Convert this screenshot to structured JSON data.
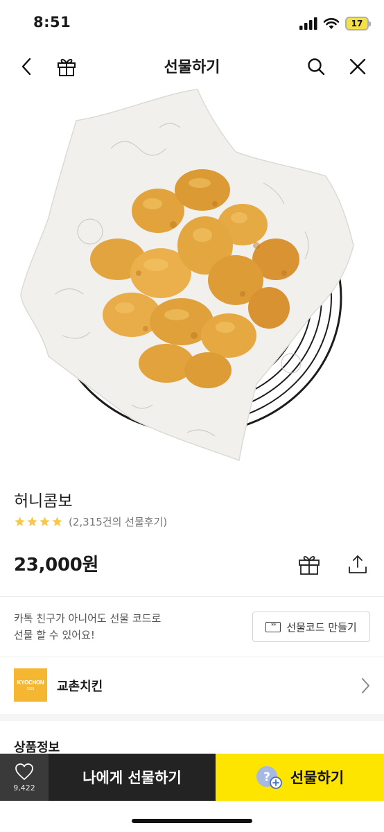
{
  "status_bar": {
    "time": "8:51",
    "battery": "17"
  },
  "nav": {
    "title": "선물하기",
    "back_icon": "chevron-left-icon",
    "gift_icon": "gift-icon",
    "search_icon": "search-icon",
    "close_icon": "close-icon"
  },
  "product": {
    "name": "허니콤보",
    "rating_stars": 4,
    "review_text": "(2,315건의 선물후기)",
    "price": "23,000원",
    "star_color": "#f7c948"
  },
  "gift_code": {
    "description_line1": "카톡 친구가 아니어도 선물 코드로",
    "description_line2": "선물 할 수 있어요!",
    "button_label": "선물코드 만들기",
    "button_icon_text": "**"
  },
  "brand": {
    "logo_main": "KYOCHON",
    "logo_sub": "1991",
    "name": "교촌치킨",
    "logo_color": "#f5b731"
  },
  "section": {
    "title": "상품정보"
  },
  "bottom_bar": {
    "like_count": "9,422",
    "self_gift_label": "나에게 선물하기",
    "gift_label": "선물하기",
    "accent_color": "#fee500"
  }
}
